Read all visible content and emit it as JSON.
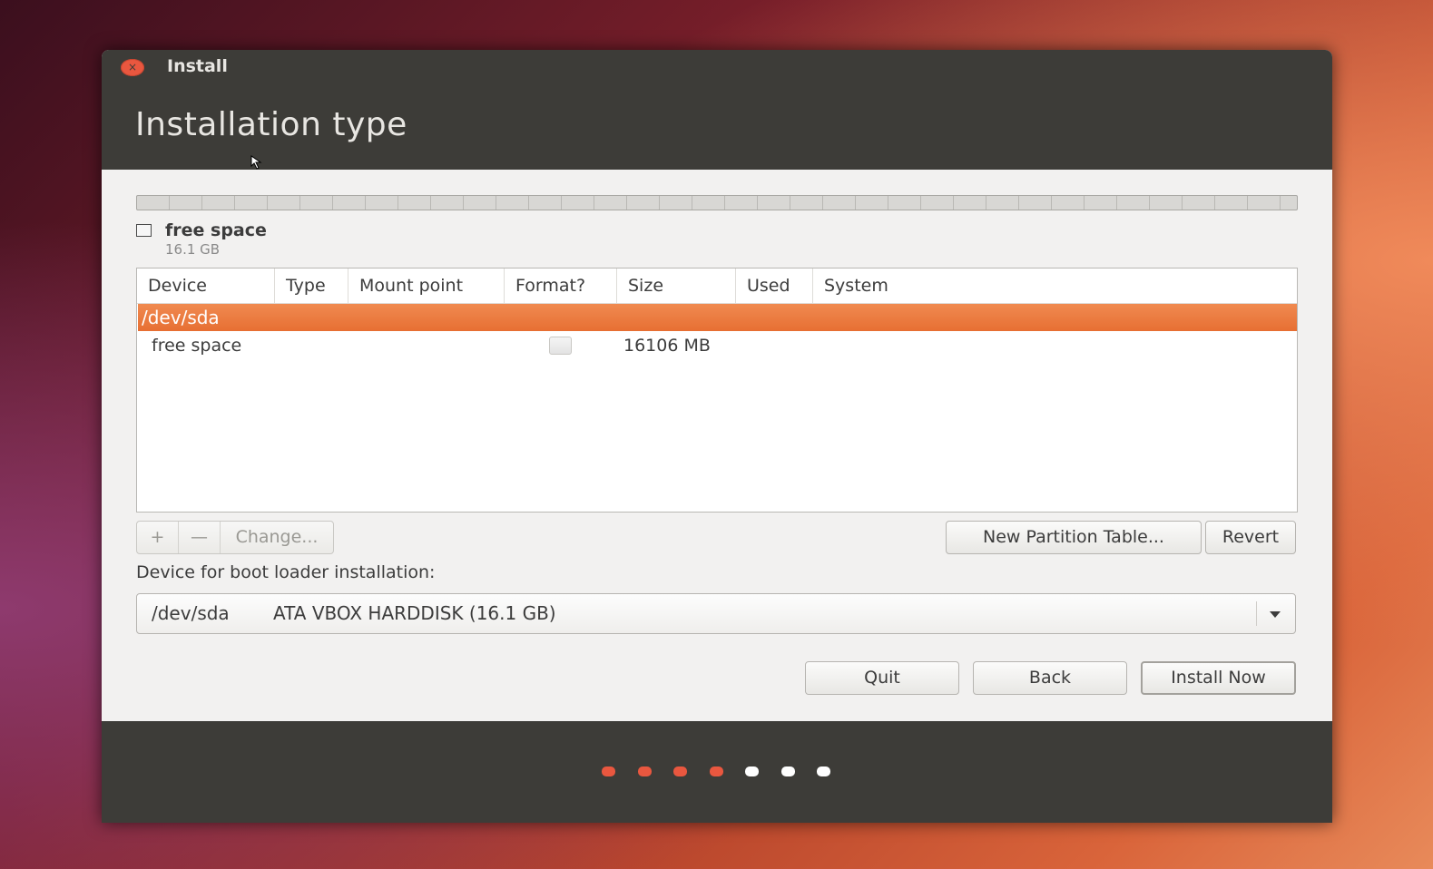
{
  "window": {
    "title": "Install",
    "close_glyph": "×"
  },
  "page_title": "Installation type",
  "free_space_legend": {
    "label": "free space",
    "size": "16.1 GB"
  },
  "table": {
    "columns": [
      "Device",
      "Type",
      "Mount point",
      "Format?",
      "Size",
      "Used",
      "System"
    ],
    "selected_row": {
      "device": "/dev/sda"
    },
    "rows": [
      {
        "device": "free space",
        "type": "",
        "mount": "",
        "format": false,
        "size": "16106 MB",
        "used": "",
        "system": ""
      }
    ]
  },
  "toolbar": {
    "add": "+",
    "remove": "—",
    "change": "Change...",
    "new_partition_table": "New Partition Table...",
    "revert": "Revert"
  },
  "boot_loader": {
    "label": "Device for boot loader installation:",
    "selected_device": "/dev/sda",
    "selected_description": "ATA VBOX HARDDISK (16.1 GB)"
  },
  "actions": {
    "quit": "Quit",
    "back": "Back",
    "install_now": "Install Now"
  },
  "progress": {
    "total_steps": 7,
    "completed_steps": 4,
    "active_color": "#e9573f",
    "inactive_color": "#ffffff"
  },
  "icons": {
    "close": "close-icon",
    "cursor": "mouse-pointer-icon",
    "dropdown": "chevron-down-icon"
  }
}
